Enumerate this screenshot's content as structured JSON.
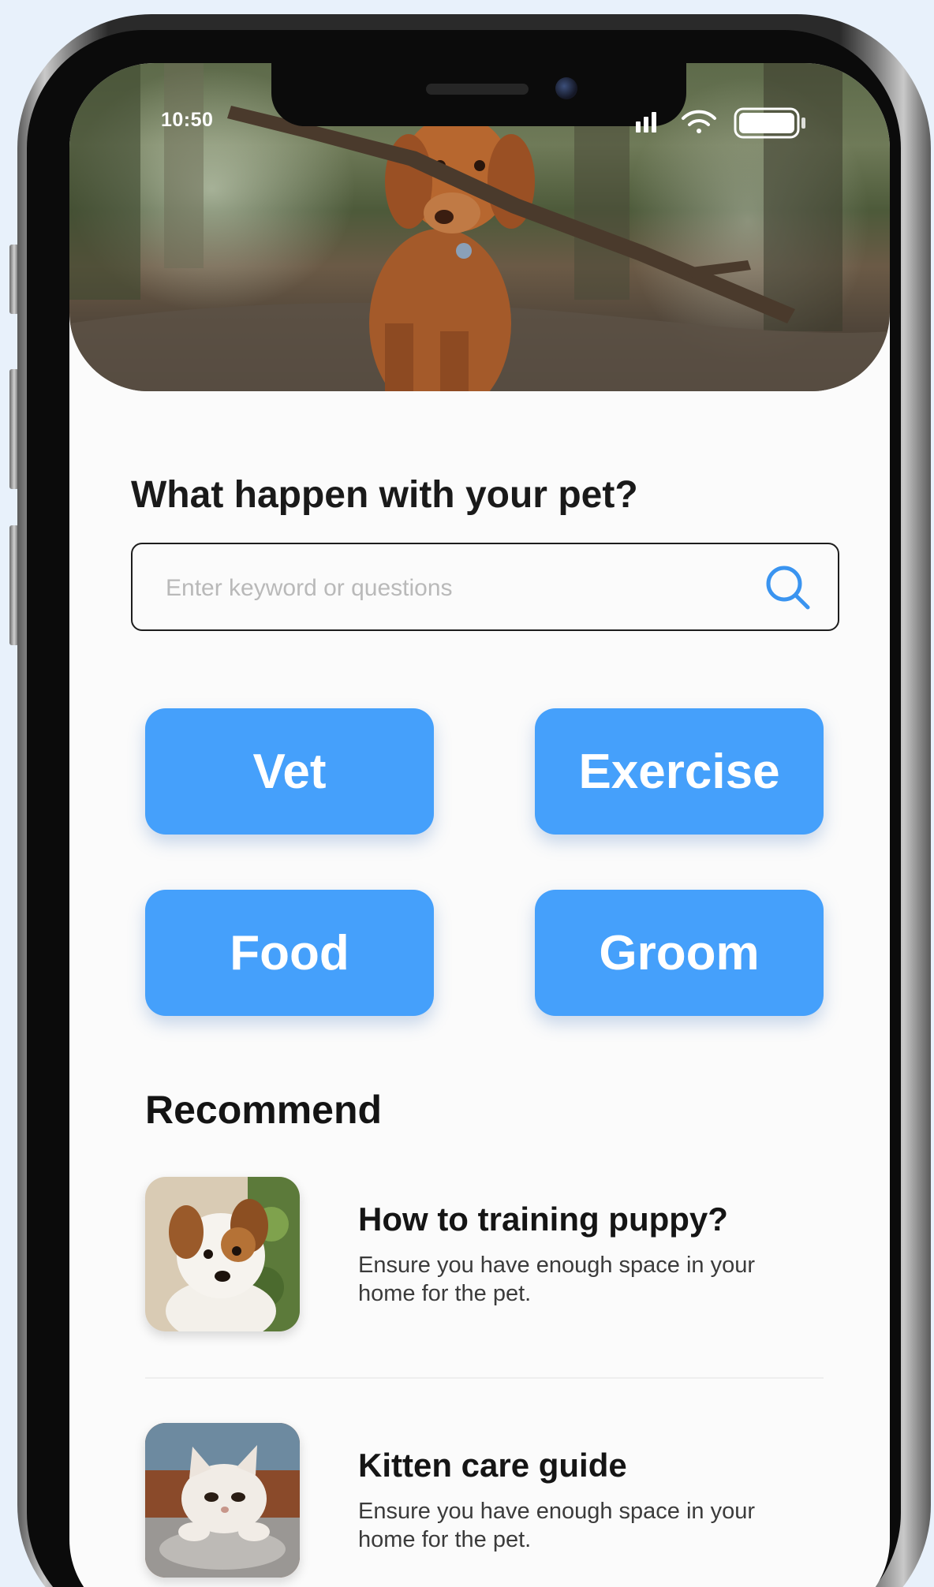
{
  "status_bar": {
    "time": "10:50"
  },
  "hero": {
    "image": "dog-with-stick-photo"
  },
  "question": "What happen with your pet?",
  "search": {
    "placeholder": "Enter keyword or questions",
    "value": "",
    "icon": "search-icon"
  },
  "categories": [
    {
      "label": "Vet"
    },
    {
      "label": "Exercise"
    },
    {
      "label": "Food"
    },
    {
      "label": "Groom"
    }
  ],
  "recommend": {
    "title": "Recommend",
    "items": [
      {
        "title": "How to training puppy?",
        "description": "Ensure you have enough space in your home for the pet.",
        "image": "puppy-photo"
      },
      {
        "title": "Kitten care guide",
        "description": "Ensure you have enough space in your home for the pet.",
        "image": "kitten-photo"
      }
    ]
  },
  "colors": {
    "accent": "#45A0FB",
    "background": "#FBFBFB",
    "text": "#1A1A1A"
  }
}
